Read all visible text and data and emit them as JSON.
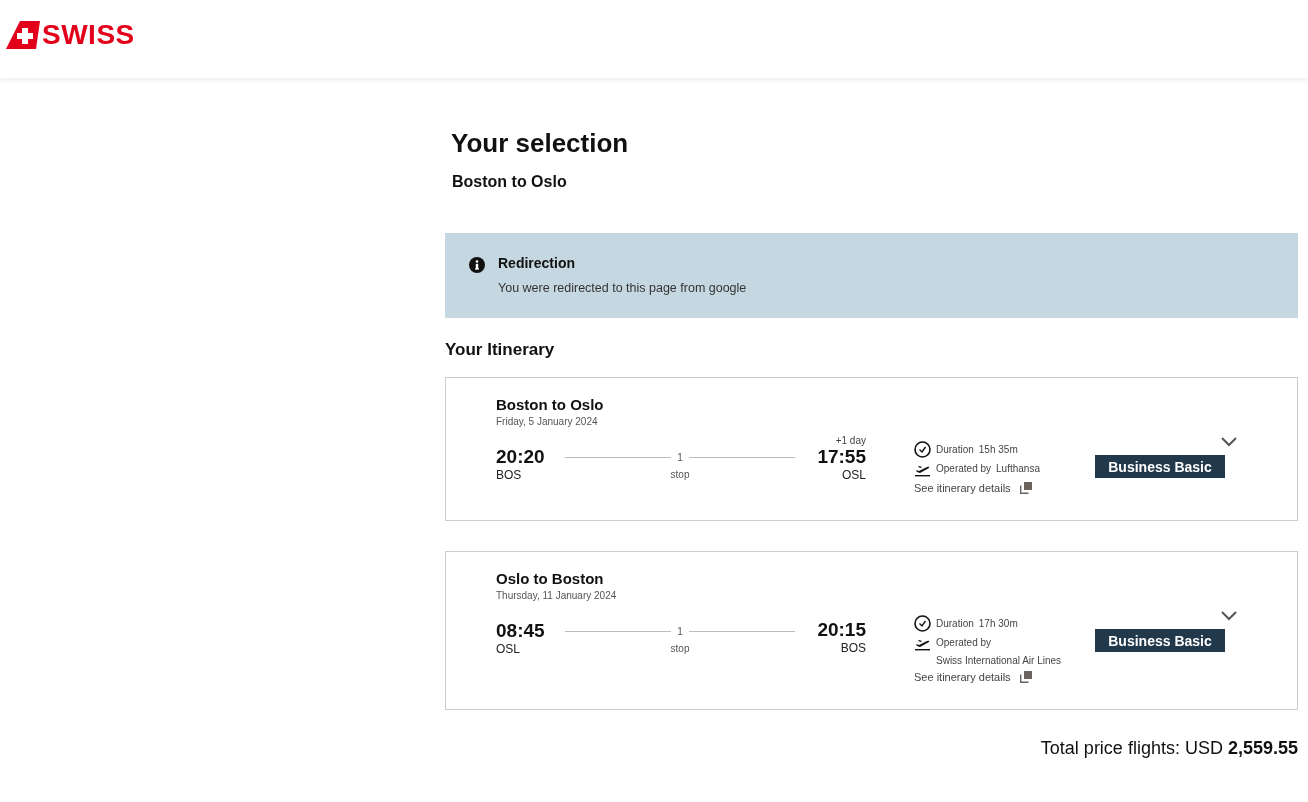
{
  "header": {
    "logo_text": "SWISS"
  },
  "title": "Your selection",
  "subtitle": "Boston to Oslo",
  "notice": {
    "title": "Redirection",
    "message": "You were redirected to this page from google"
  },
  "itinerary_heading": "Your Itinerary",
  "flights": [
    {
      "route": "Boston to Oslo",
      "date": "Friday, 5 January 2024",
      "departure_time": "20:20",
      "departure_airport": "BOS",
      "stops": "1",
      "stops_label": "stop",
      "arrival_time": "17:55",
      "arrival_airport": "OSL",
      "day_offset": "+1 day",
      "duration_label": "Duration",
      "duration": "15h 35m",
      "operated_label": "Operated by",
      "carrier": "Lufthansa",
      "details_link": "See itinerary details",
      "fare": "Business Basic",
      "expanded": false
    },
    {
      "route": "Oslo to Boston",
      "date": "Thursday, 11 January 2024",
      "departure_time": "08:45",
      "departure_airport": "OSL",
      "stops": "1",
      "stops_label": "stop",
      "arrival_time": "20:15",
      "arrival_airport": "BOS",
      "duration_label": "Duration",
      "duration": "17h 30m",
      "operated_label": "Operated by",
      "carrier": "Swiss International Air Lines",
      "details_link": "See itinerary details",
      "fare": "Business Basic",
      "expanded": false
    }
  ],
  "total": "Total price flights: USD **2,559.55**"
}
